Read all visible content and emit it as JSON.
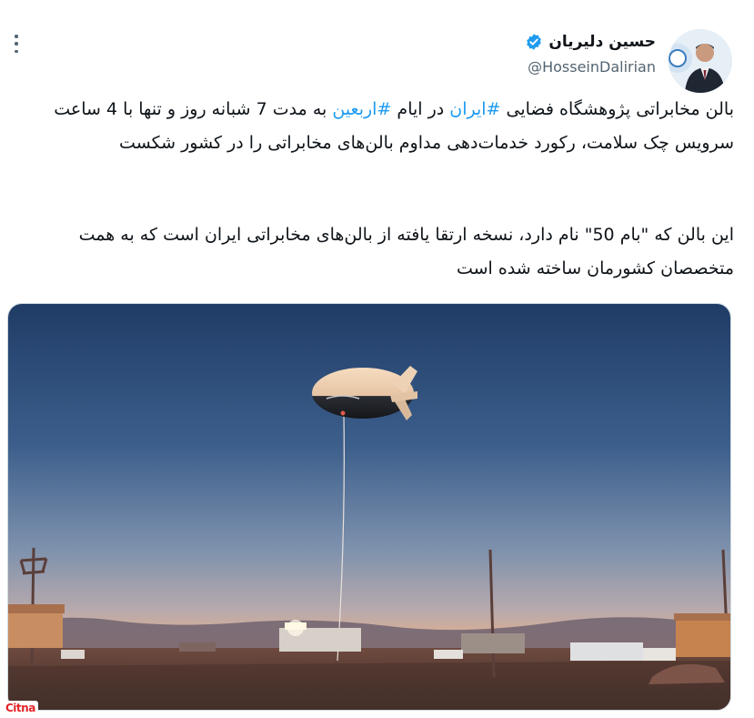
{
  "author": {
    "display_name": "حسین دلیریان",
    "handle": "@HosseinDalirian",
    "verified": true,
    "verified_color": "#1d9bf0"
  },
  "tweet": {
    "p1_part1": "بالن مخابراتی پژوهشگاه فضایی ",
    "hashtag_iran": "#ایران",
    "p1_part2": " در ایام ",
    "hashtag_arbaeen": "#اربعین",
    "p1_part3": " به مدت 7 شبانه روز و تنها با 4 ساعت سرویس چک سلامت، رکورد خدمات‌دهی مداوم بالن‌های مخابراتی را در کشور شکست",
    "p2": "این بالن که \"بام 50\" نام دارد، نسخه ارتقا یافته از بالن‌های مخابراتی ایران است که به همت متخصصان کشورمان ساخته شده است"
  },
  "media": {
    "alt": "aerostat balloon at dusk"
  },
  "watermark": {
    "text": "Citna"
  },
  "icons": {
    "more": "more-options-icon",
    "verified": "verified-badge-icon"
  },
  "colors": {
    "link": "#1d9bf0",
    "secondary_text": "#536471",
    "watermark": "#e3242b"
  }
}
